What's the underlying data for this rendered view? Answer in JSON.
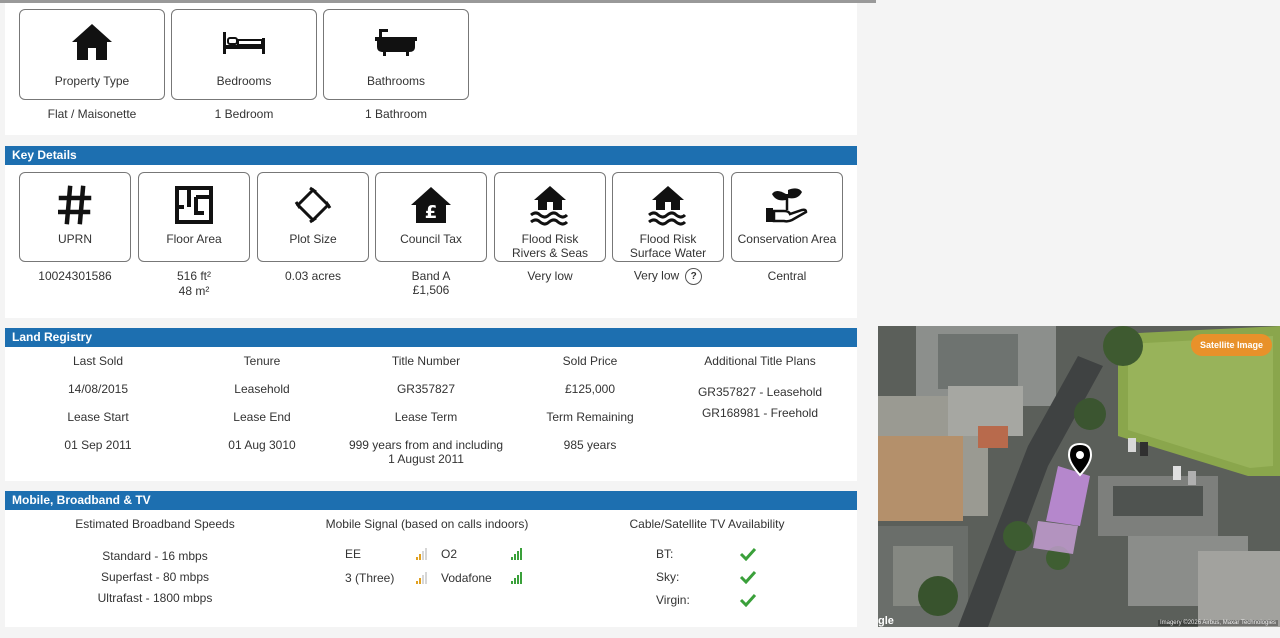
{
  "property": [
    {
      "label": "Property Type",
      "value": "Flat / Maisonette",
      "icon": "house-icon"
    },
    {
      "label": "Bedrooms",
      "value": "1 Bedroom",
      "icon": "bed-icon"
    },
    {
      "label": "Bathrooms",
      "value": "1 Bathroom",
      "icon": "bathtub-icon"
    }
  ],
  "key_details": {
    "title": "Key Details",
    "items": [
      {
        "label": "UPRN",
        "value": "10024301586",
        "icon": "hash-icon"
      },
      {
        "label": "Floor Area",
        "value": "516 ft²",
        "value2": "48 m²",
        "icon": "floorplan-icon"
      },
      {
        "label": "Plot Size",
        "value": "0.03 acres",
        "icon": "plot-icon"
      },
      {
        "label": "Council Tax",
        "value": "Band A",
        "value2": "£1,506",
        "icon": "council-tax-icon"
      },
      {
        "label": "Flood Risk",
        "label2": "Rivers & Seas",
        "value": "Very low",
        "icon": "flood-icon"
      },
      {
        "label": "Flood Risk",
        "label2": "Surface Water",
        "value": "Very low",
        "help": "?",
        "icon": "flood-icon"
      },
      {
        "label": "Conservation Area",
        "value": "Central",
        "icon": "plant-hand-icon"
      }
    ]
  },
  "land_registry": {
    "title": "Land Registry",
    "headers1": [
      "Last Sold",
      "Tenure",
      "Title Number",
      "Sold Price",
      "Additional Title Plans"
    ],
    "values1": [
      "14/08/2015",
      "Leasehold",
      "GR357827",
      "£125,000"
    ],
    "title_plans": [
      "GR357827 - Leasehold",
      "GR168981 - Freehold"
    ],
    "headers2": [
      "Lease Start",
      "Lease End",
      "Lease Term",
      "Term Remaining"
    ],
    "values2": [
      "01 Sep 2011",
      "01 Aug 3010",
      "999 years from and including",
      "985 years"
    ],
    "lease_term_line2": "1 August 2011"
  },
  "mobile": {
    "title": "Mobile, Broadband & TV",
    "broadband_title": "Estimated Broadband Speeds",
    "broadband": [
      "Standard - 16 mbps",
      "Superfast - 80 mbps",
      "Ultrafast - 1800 mbps"
    ],
    "signal_title": "Mobile Signal (based on calls indoors)",
    "networks": [
      {
        "name": "EE",
        "bars": 2,
        "color": "#e0a020"
      },
      {
        "name": "O2",
        "bars": 4,
        "color": "#3aa03a"
      },
      {
        "name": "3 (Three)",
        "bars": 2,
        "color": "#e0a020"
      },
      {
        "name": "Vodafone",
        "bars": 4,
        "color": "#3aa03a"
      }
    ],
    "tv_title": "Cable/Satellite TV Availability",
    "tv": [
      "BT:",
      "Sky:",
      "Virgin:"
    ]
  },
  "map": {
    "satellite_button": "Satellite Image",
    "attribution": "Imagery ©2026 Airbus, Maxar Technologies",
    "google_fragment": "gle"
  },
  "colors": {
    "header_bar": "#1d6fb0",
    "check": "#3aa03a",
    "satellite_button": "#e8912a"
  }
}
